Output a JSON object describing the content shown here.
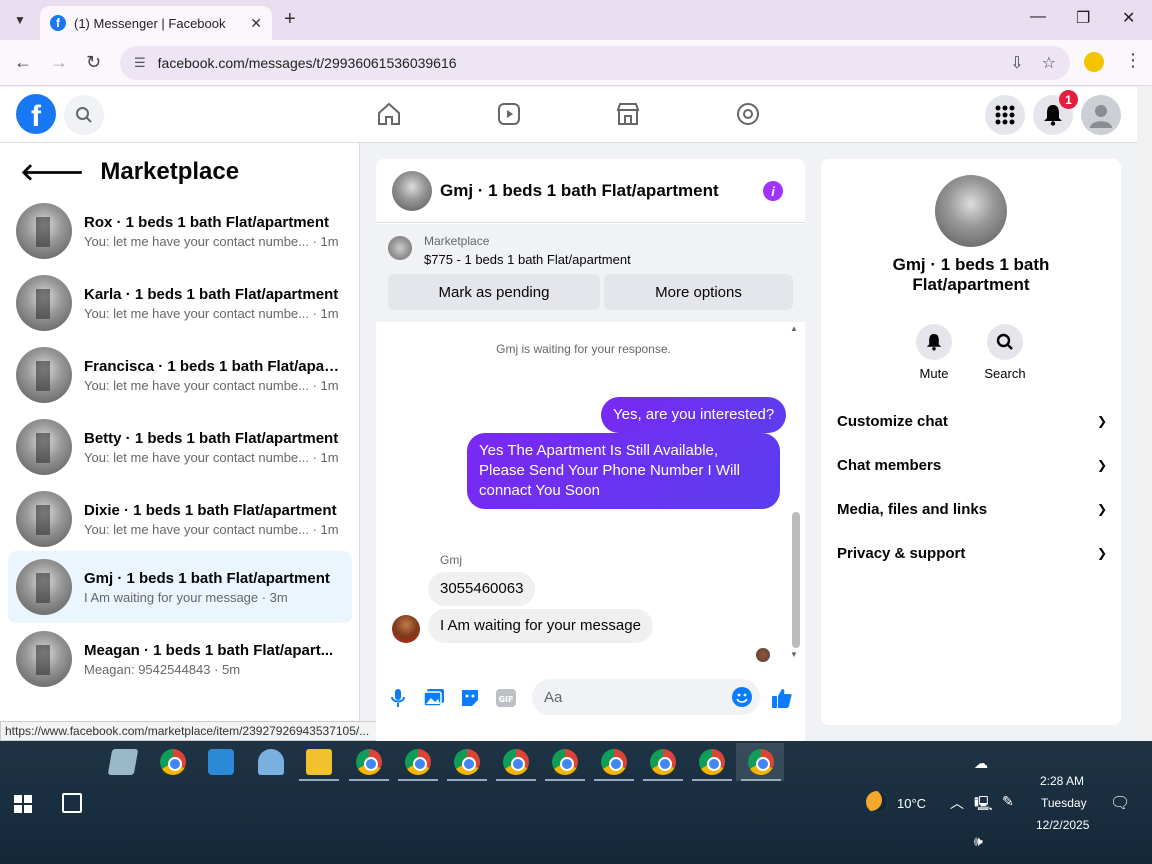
{
  "browser": {
    "tab_title": "(1) Messenger | Facebook",
    "url": "facebook.com/messages/t/29936061536039616",
    "status_url": "https://www.facebook.com/marketplace/item/23927926943537105/..."
  },
  "header": {
    "notification_count": "1",
    "brand_color": "#1877f2"
  },
  "left": {
    "title": "Marketplace",
    "conversations": [
      {
        "name": "Rox · 1 beds 1 bath Flat/apartment",
        "preview": "You: let me have your contact numbe... · 1m"
      },
      {
        "name": "Karla · 1 beds 1 bath Flat/apartment",
        "preview": "You: let me have your contact numbe... · 1m"
      },
      {
        "name": "Francisca · 1 beds 1 bath Flat/apart...",
        "preview": "You: let me have your contact numbe... · 1m"
      },
      {
        "name": "Betty · 1 beds 1 bath Flat/apartment",
        "preview": "You: let me have your contact numbe... · 1m"
      },
      {
        "name": "Dixie · 1 beds 1 bath Flat/apartment",
        "preview": "You: let me have your contact numbe... · 1m"
      },
      {
        "name": "Gmj · 1 beds 1 bath Flat/apartment",
        "preview": "I Am waiting for your message · 3m"
      },
      {
        "name": "Meagan · 1 beds 1 bath Flat/apart...",
        "preview": "Meagan: 9542544843 · 5m"
      }
    ]
  },
  "chat": {
    "title": "Gmj · 1 beds 1 bath Flat/apartment",
    "marketplace_label": "Marketplace",
    "listing": "$775 - 1 beds 1 bath Flat/apartment",
    "mark_pending": "Mark as pending",
    "more_options": "More options",
    "waiting_notice": "Gmj is waiting for your response.",
    "messages_out": [
      "Yes, are you interested?",
      "Yes The Apartment Is Still Available, Please Send Your Phone Number I Will connact You Soon"
    ],
    "sender_name": "Gmj",
    "messages_in": [
      "3055460063",
      "I Am waiting for your message"
    ],
    "composer_placeholder": "Aa",
    "accent_color": "#7a28f2"
  },
  "right": {
    "title": "Gmj · 1 beds 1 bath Flat/apartment",
    "actions": [
      "Mute",
      "Search"
    ],
    "sections": [
      "Customize chat",
      "Chat members",
      "Media, files and links",
      "Privacy & support"
    ]
  },
  "taskbar": {
    "temperature": "10°C",
    "time": "2:28 AM",
    "day": "Tuesday",
    "date": "12/2/2025"
  }
}
